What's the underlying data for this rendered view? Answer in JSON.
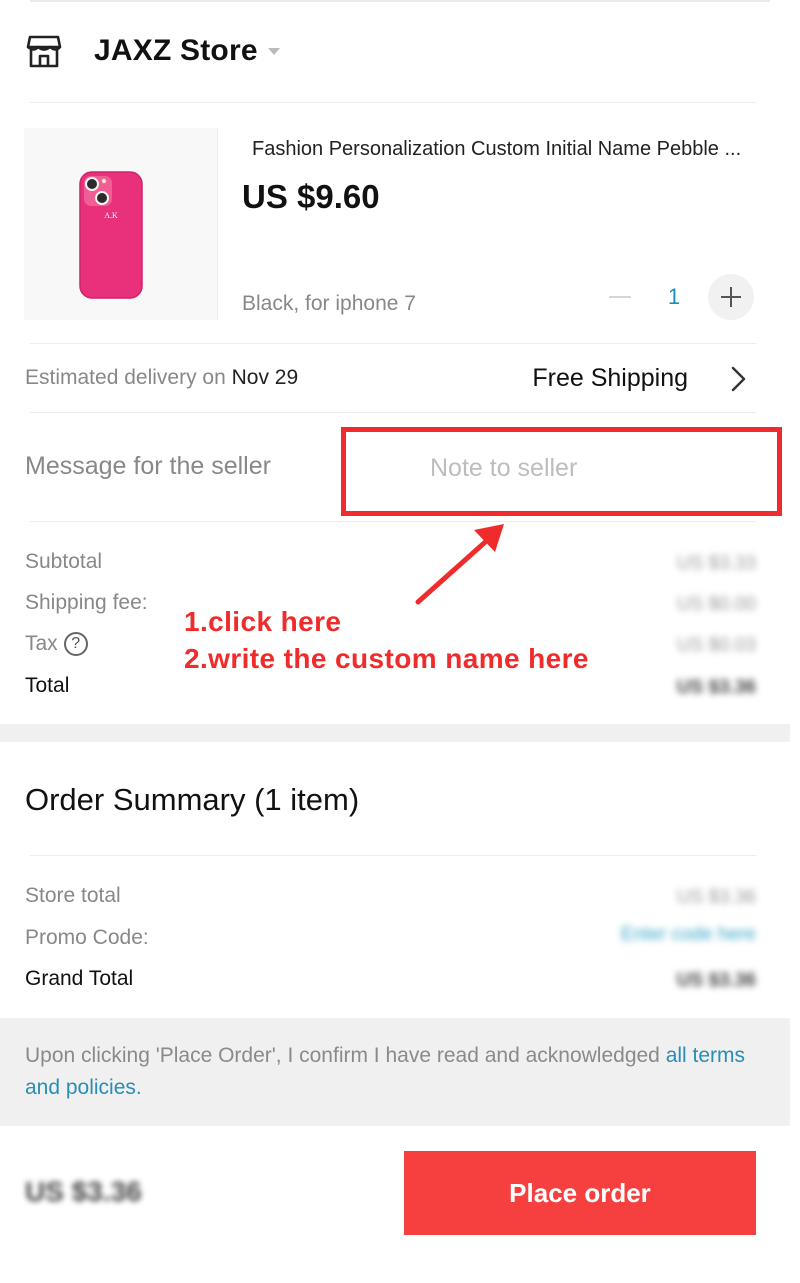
{
  "store": {
    "name": "JAXZ Store",
    "icon": "store-icon"
  },
  "product": {
    "title": "Fashion Personalization Custom Initial Name Pebble ...",
    "price": "US $9.60",
    "variant": "Black, for iphone 7",
    "quantity": "1",
    "case_color": "#e8317a",
    "case_text": "A.K"
  },
  "delivery": {
    "label": "Estimated delivery on ",
    "date": "Nov 29",
    "shipping": "Free Shipping"
  },
  "message": {
    "label": "Message for the seller",
    "placeholder": "Note to seller"
  },
  "costs": {
    "subtotal_label": "Subtotal",
    "subtotal_value": "US $3.33",
    "shipping_label": "Shipping fee:",
    "shipping_value": "US $0.00",
    "tax_label": "Tax",
    "tax_help": "?",
    "tax_value": "US $0.03",
    "total_label": "Total",
    "total_value": "US $3.36"
  },
  "annotation": {
    "line1": "1.click here",
    "line2": "2.write the custom name here",
    "color": "#ef2b2b"
  },
  "summary": {
    "title": "Order Summary (1 item)",
    "store_total_label": "Store total",
    "store_total_value": "US $3.36",
    "promo_label": "Promo Code:",
    "promo_link": "Enter code here",
    "grand_total_label": "Grand Total",
    "grand_total_value": "US $3.36"
  },
  "terms": {
    "text": "Upon clicking 'Place Order', I confirm I have read and acknowledged ",
    "link": "all terms and policies."
  },
  "footer": {
    "total": "US $3.36",
    "place_order_label": "Place order",
    "button_color": "#f64040"
  }
}
